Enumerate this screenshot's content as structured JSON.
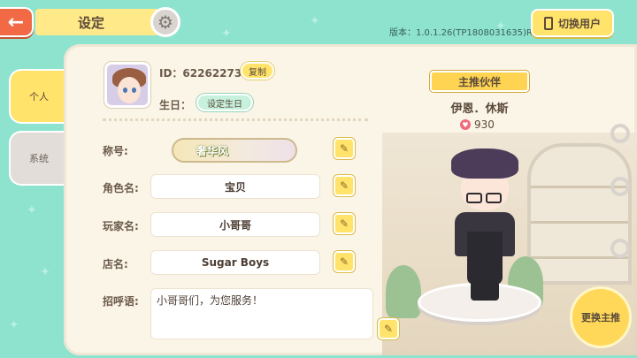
{
  "header": {
    "back_label": "←",
    "title": "设定",
    "version": "版本：1.0.1.26(TP1808031635)R",
    "switch_user_label": "切换用户"
  },
  "side_tabs": [
    {
      "label": "个人",
      "active": true
    },
    {
      "label": "系统",
      "active": false
    }
  ],
  "profile": {
    "id_text": "ID：62262273",
    "copy_label": "复制",
    "birthday_label": "生日：",
    "set_birthday_label": "设定生日"
  },
  "fields": {
    "title_label": "称号:",
    "title_value": "奢华风",
    "role_label": "角色名:",
    "role_value": "宝贝",
    "player_label": "玩家名:",
    "player_value": "小哥哥",
    "shop_label": "店名:",
    "shop_value": "Sugar Boys",
    "greeting_label": "招呼语:",
    "greeting_value": "小哥哥们，为您服务！"
  },
  "partner": {
    "ribbon": "主推伙伴",
    "name": "伊恩．休斯",
    "affection": "930",
    "change_label": "更换主推"
  },
  "colors": {
    "background": "#8ee3cf",
    "accent_yellow": "#ffe36a",
    "back_orange": "#f26a45",
    "panel": "#fbf5e8"
  },
  "icons": [
    "back-arrow-icon",
    "gear-icon",
    "phone-icon",
    "pencil-icon",
    "heart-icon"
  ]
}
